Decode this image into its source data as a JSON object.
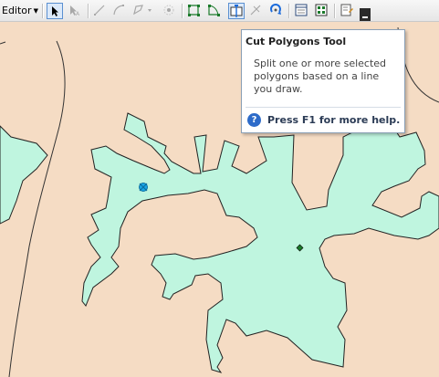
{
  "toolbar": {
    "editor_menu_label": "Editor",
    "tools": [
      {
        "name": "edit-tool",
        "icon": "arrow-pointer-icon",
        "active": true
      },
      {
        "name": "edit-annotation-tool",
        "icon": "annotation-arrow-icon"
      },
      {
        "name": "straight-segment-tool",
        "icon": "line-segment-icon"
      },
      {
        "name": "endpoint-arc-tool",
        "icon": "arc-icon"
      },
      {
        "name": "trace-tool",
        "icon": "polygon-construct-icon"
      },
      {
        "name": "point-tool",
        "icon": "point-icon"
      },
      {
        "name": "edit-vertices-tool",
        "icon": "vertices-icon"
      },
      {
        "name": "reshape-feature-tool",
        "icon": "reshape-icon"
      },
      {
        "name": "cut-polygons-tool",
        "icon": "cut-polygons-icon",
        "active": true
      },
      {
        "name": "split-tool",
        "icon": "split-icon"
      },
      {
        "name": "rotate-tool",
        "icon": "rotate-icon"
      },
      {
        "name": "attributes-button",
        "icon": "attributes-table-icon"
      },
      {
        "name": "sketch-properties-button",
        "icon": "sketch-properties-icon"
      },
      {
        "name": "create-features-button",
        "icon": "create-features-icon"
      },
      {
        "name": "toolbar-options-button",
        "icon": "overflow-chevron-icon"
      }
    ]
  },
  "tooltip": {
    "title": "Cut Polygons Tool",
    "description": "Split one or more selected polygons based on a line you draw.",
    "help_text": "Press F1 for more help."
  },
  "colors": {
    "map_background": "#f5dcc4",
    "polygon_fill": "#bff5df",
    "polygon_outline": "#222222",
    "selection_marker": "#1aa7e6"
  }
}
